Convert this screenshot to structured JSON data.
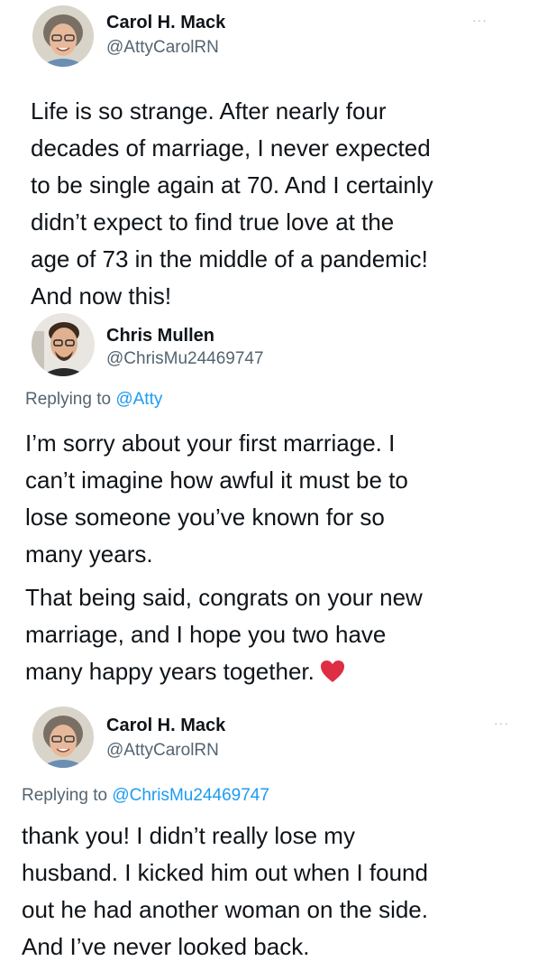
{
  "tweets": [
    {
      "author_name": "Carol H. Mack",
      "author_handle": "@AttyCarolRN",
      "avatar_icon": "profile-photo-icon",
      "more_icon": "more-options-icon",
      "more_label": "···",
      "paragraphs": [
        [
          "Life is so strange. After nearly four",
          "decades of marriage, I never expected",
          "to be single again at 70. And I certainly",
          "didn’t expect to find true love at the",
          "age of 73 in the middle of a pandemic!",
          "And now this!"
        ]
      ]
    },
    {
      "author_name": "Chris Mullen",
      "author_handle": "@ChrisMu24469747",
      "avatar_icon": "profile-photo-icon",
      "reply_prefix": "Replying to ",
      "reply_mention": "@Atty",
      "paragraphs": [
        [
          "I’m sorry about your first marriage. I",
          "can’t imagine how awful it must be to",
          "lose someone you’ve known for so",
          "many years."
        ],
        [
          "That being said, congrats on your new",
          "marriage, and I hope you two have",
          "many happy years together."
        ]
      ],
      "emoji": "red-heart-icon",
      "emoji_color": "#dd2e44"
    },
    {
      "author_name": "Carol H. Mack",
      "author_handle": "@AttyCarolRN",
      "avatar_icon": "profile-photo-icon",
      "more_icon": "more-options-icon",
      "more_label": "···",
      "reply_prefix": "Replying to ",
      "reply_mention": "@ChrisMu24469747",
      "paragraphs": [
        [
          "thank you! I didn’t really lose my",
          "husband. I kicked him out when I found",
          "out he had another woman on the side.",
          "And I’ve never looked back."
        ]
      ]
    }
  ],
  "colors": {
    "text": "#0f1419",
    "secondary": "#536471",
    "link": "#1d9bf0",
    "heart": "#dd2e44"
  }
}
